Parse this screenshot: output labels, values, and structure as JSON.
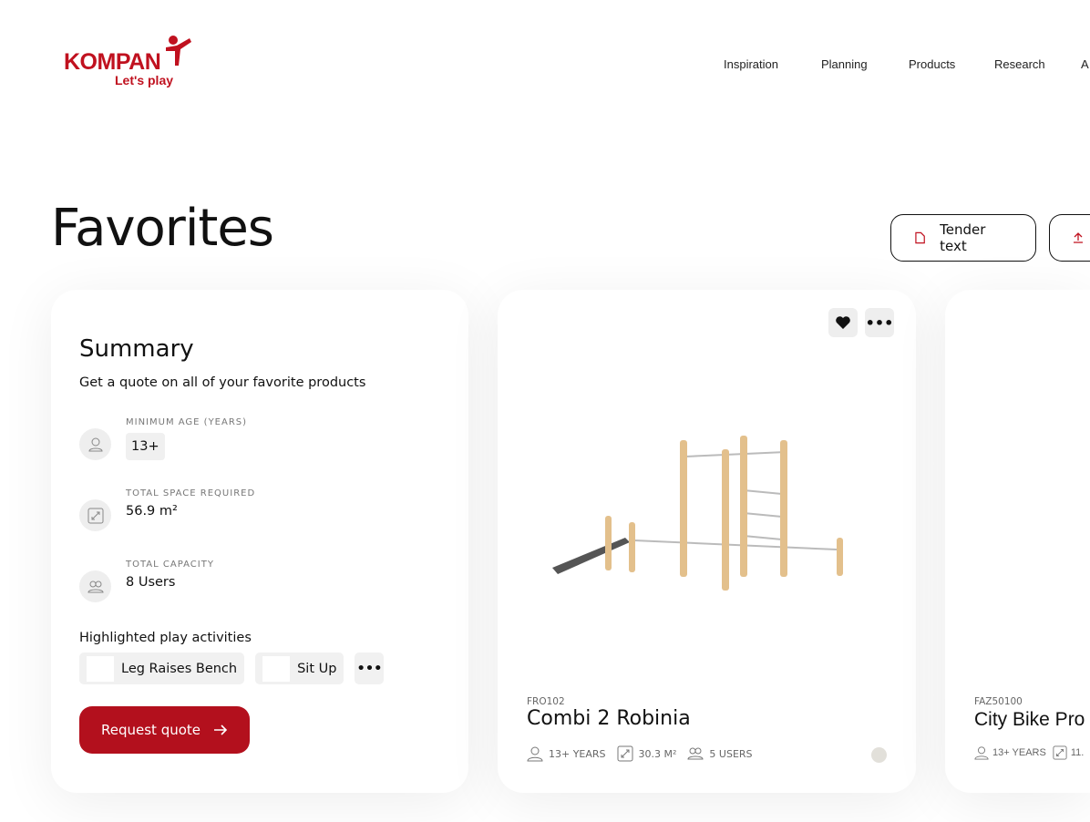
{
  "brand": {
    "name": "KOMPAN",
    "tagline": "Let's play",
    "color": "#c0111f"
  },
  "nav": [
    "Inspiration",
    "Planning",
    "Products",
    "Research",
    "A"
  ],
  "page_title": "Favorites",
  "actions": [
    {
      "label": "Tender text",
      "icon": "document-icon"
    },
    {
      "label": "",
      "icon": "upload-icon"
    }
  ],
  "summary": {
    "title": "Summary",
    "subtitle": "Get a quote on all of your favorite products",
    "stats": [
      {
        "label": "MINIMUM AGE (YEARS)",
        "value": "13+",
        "icon": "person-icon"
      },
      {
        "label": "TOTAL SPACE REQUIRED",
        "value": "56.9 m²",
        "icon": "expand-icon"
      },
      {
        "label": "TOTAL CAPACITY",
        "value": "8 Users",
        "icon": "users-icon"
      }
    ],
    "activities_label": "Highlighted play activities",
    "activities": [
      "Leg Raises Bench",
      "Sit Up"
    ],
    "more": "•••",
    "cta": "Request quote"
  },
  "products": [
    {
      "code": "FRO102",
      "name": "Combi 2 Robinia",
      "age": "13+ YEARS",
      "space": "30.3 M²",
      "users": "5 USERS",
      "favorited": true,
      "swatch": "#e2e0da"
    },
    {
      "code": "FAZ50100",
      "name": "City Bike Pro",
      "age": "13+ YEARS",
      "space": "11."
    }
  ]
}
